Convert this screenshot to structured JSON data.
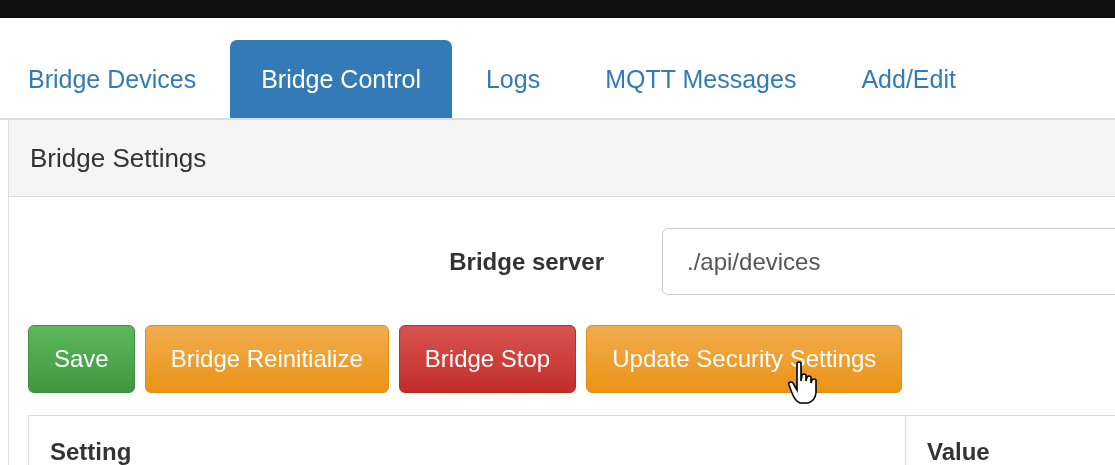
{
  "tabs": [
    {
      "label": "Bridge Devices",
      "selected": false
    },
    {
      "label": "Bridge Control",
      "selected": true
    },
    {
      "label": "Logs",
      "selected": false
    },
    {
      "label": "MQTT Messages",
      "selected": false
    },
    {
      "label": "Add/Edit",
      "selected": false
    }
  ],
  "panel": {
    "title": "Bridge Settings"
  },
  "form": {
    "label": "Bridge server",
    "value": "./api/devices"
  },
  "buttons": [
    {
      "label": "Save",
      "kind": "success"
    },
    {
      "label": "Bridge Reinitialize",
      "kind": "warning"
    },
    {
      "label": "Bridge Stop",
      "kind": "danger"
    },
    {
      "label": "Update Security Settings",
      "kind": "warning"
    }
  ],
  "table": {
    "columns": [
      "Setting",
      "Value"
    ]
  }
}
